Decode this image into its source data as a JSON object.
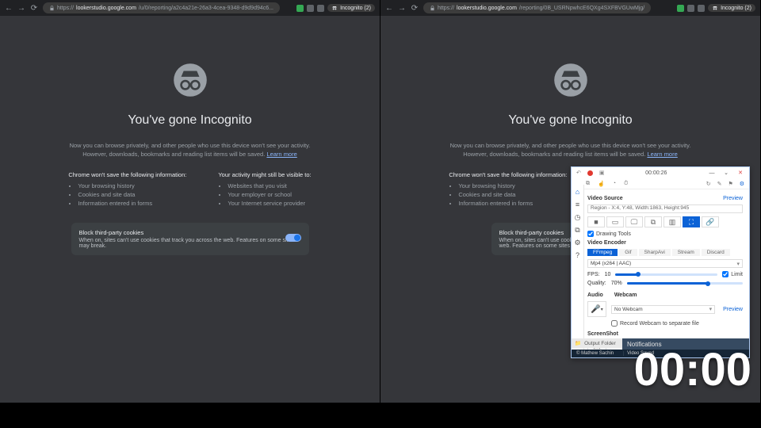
{
  "browser": {
    "back": "←",
    "fwd": "→",
    "reload": "⟳",
    "url_prefix": "https://",
    "url_host": "lookerstudio.google.com",
    "url1_path": "/u/0/reporting/a2c4a21e-26a3-4cea-9348-d9d9d94c6...",
    "url2_path": "/reporting/0B_USRNpwhcE6QXg4SXFBVGUwMjg/",
    "incognito_chip": "Incognito (2)"
  },
  "incog": {
    "title": "You've gone Incognito",
    "blurb1": "Now you can browse privately, and other people who use this device won't see your activity.",
    "blurb2": "However, downloads, bookmarks and reading list items will be saved.",
    "learn_more": "Learn more",
    "left_head": "Chrome won't save the following information:",
    "left_items": [
      "Your browsing history",
      "Cookies and site data",
      "Information entered in forms"
    ],
    "right_head": "Your activity might still be visible to:",
    "right_items": [
      "Websites that you visit",
      "Your employer or school",
      "Your Internet service provider"
    ],
    "cookie_title": "Block third-party cookies",
    "cookie_body": "When on, sites can't use cookies that track you across the web. Features on some sites may break."
  },
  "captura": {
    "elapsed": "00:00:26",
    "video_source": "Video Source",
    "preview": "Preview",
    "region_text": "Region - X:4, Y:48, Width:1863, Height:945",
    "drawing_tools": "Drawing Tools",
    "video_encoder": "Video Encoder",
    "enc_tabs": [
      "FFmpeg",
      "Gif",
      "SharpAvi",
      "Stream",
      "Discard"
    ],
    "codec": "Mp4 (x264 | AAC)",
    "fps_label": "FPS:",
    "fps_val": "10",
    "limit": "Limit",
    "quality_label": "Quality:",
    "quality_val": "70%",
    "audio": "Audio",
    "webcam": "Webcam",
    "webcam_sel": "No Webcam",
    "webcam_rec": "Record Webcam to separate file",
    "screenshot": "ScreenShot",
    "output_folder": "Output Folder",
    "notif": "Notifications",
    "taskbar_user": "Mathew Sachin",
    "taskbar_saved": "Video Saved"
  },
  "overlay_clock": "00:00"
}
